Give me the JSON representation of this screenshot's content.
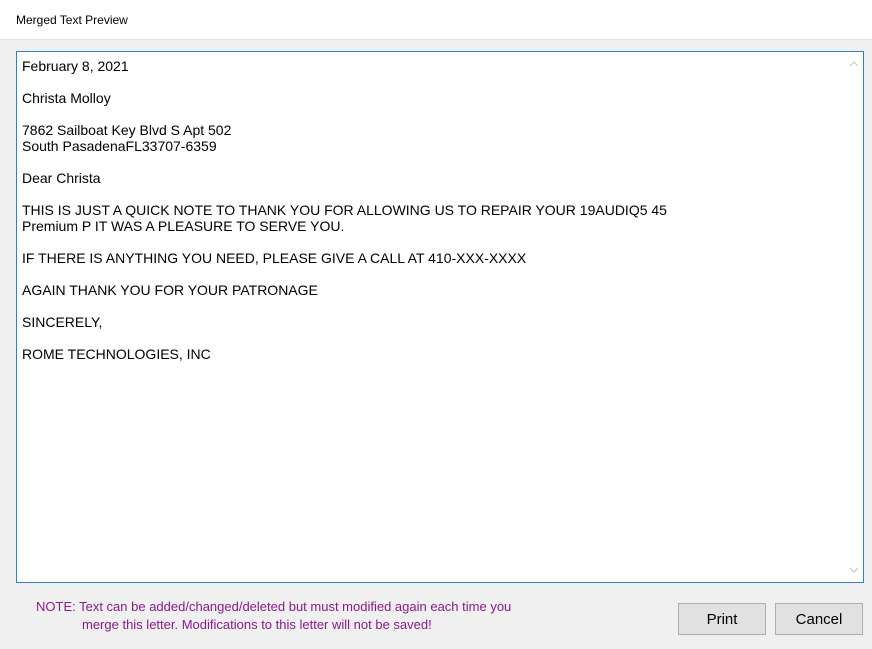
{
  "window": {
    "title": "Merged Text Preview"
  },
  "editor": {
    "text": "February 8, 2021\n\nChrista Molloy\n\n7862 Sailboat Key Blvd S Apt 502\nSouth PasadenaFL33707-6359\n\nDear Christa\n\nTHIS IS JUST A QUICK NOTE TO THANK YOU FOR ALLOWING US TO REPAIR YOUR 19AUDIQ5 45\nPremium P IT WAS A PLEASURE TO SERVE YOU.\n\nIF THERE IS ANYTHING YOU NEED, PLEASE GIVE A CALL AT 410-XXX-XXXX\n\nAGAIN THANK YOU FOR YOUR PATRONAGE\n\nSINCERELY,\n\nROME TECHNOLOGIES, INC"
  },
  "note": {
    "line1": "NOTE:  Text can be added/changed/deleted but must modified again each time you",
    "line2": "merge this letter.  Modifications to this letter will not be saved!",
    "color": "#8b1a8b"
  },
  "buttons": {
    "print_label": "Print",
    "cancel_label": "Cancel"
  },
  "icons": {
    "scroll_up": "chevron-up-icon",
    "scroll_down": "chevron-down-icon"
  },
  "colors": {
    "focus_border": "#2f7fd2",
    "dialog_background": "#f0f0f0"
  }
}
